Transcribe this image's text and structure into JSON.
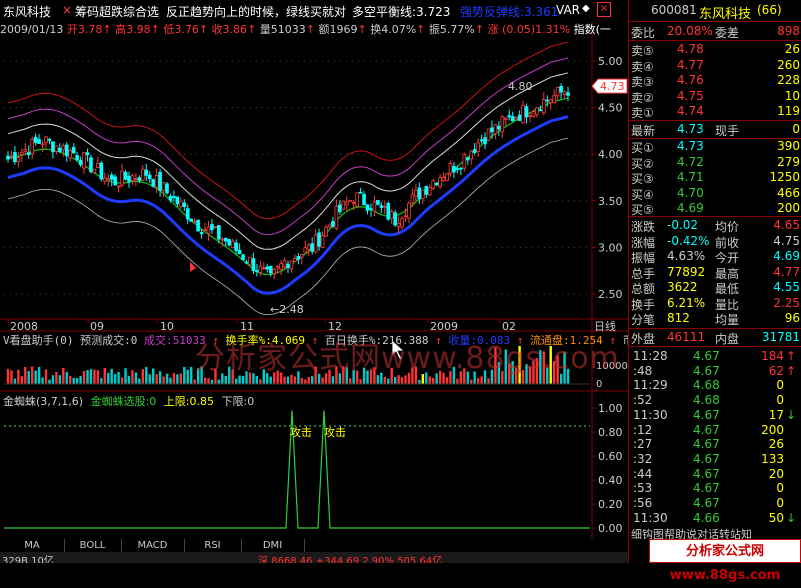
{
  "header": {
    "stock_name": "东风科技",
    "formula_name": "筹码超跌综合选",
    "slogan": "反正趋势向上的时候，绿线买就对",
    "balance_label": "多空平衡线:3.723",
    "rebound_label": "强势反弹线:3.361",
    "var_label": "VAR"
  },
  "ohlc_line": {
    "date": "2009/01/13",
    "open": "开3.78",
    "high": "高3.98",
    "low": "低3.76",
    "close": "收3.86",
    "volume": "量51033",
    "amount": "额1969",
    "turnover": "换4.07%",
    "amplitude": "振5.77%",
    "change": "涨 (0.05)1.31%",
    "index_label": "指数(一"
  },
  "price_axis": [
    "5.00",
    "4.50",
    "4.00",
    "3.50",
    "3.00",
    "2.50"
  ],
  "price_annotations": {
    "high_marker": "4.80",
    "low_marker": "2.48",
    "current_tag": "4.73"
  },
  "time_axis": [
    "2008",
    "09",
    "10",
    "11",
    "12",
    "2009",
    "02"
  ],
  "time_axis_right": "日线",
  "volume_panel": {
    "title": "V看盘助手(0)",
    "predict": "预测成交:0",
    "volume": "成交:51033",
    "turnover": "换手率%:4.069",
    "hundred_day": "百日换手%:216.388",
    "harvest": "收量:0.083",
    "circulation": "流通盘:1.254",
    "extra": "币",
    "axis": [
      "100000",
      "0"
    ]
  },
  "spider_panel": {
    "title": "金蜘蛛(3,7,1,6)",
    "select": "金蜘蛛选股:0",
    "upper": "上限:0.85",
    "lower": "下限:0",
    "attack1": "攻击",
    "attack2": "攻击",
    "axis": [
      "1.00",
      "0.80",
      "0.60",
      "0.40",
      "0.20",
      "0.00"
    ]
  },
  "tabs": [
    "MA",
    "BOLL",
    "MACD",
    "RSI",
    "DMI"
  ],
  "status_bar": {
    "left": "329B 10亿",
    "mid": "深 8668.46 +344.69 2.90% 505.64亿"
  },
  "watermark": "分析家公式网www.88gs.com",
  "watermark_box": "分析家公式网www.88gs.com",
  "quote": {
    "code": "600081",
    "name": "东风科技",
    "rank": "(66)",
    "weibi_label": "委比",
    "weibi_value": "20.08%",
    "weicha_label": "委差",
    "weicha_value": "898",
    "asks": [
      {
        "label": "卖⑤",
        "price": "4.78",
        "vol": "26"
      },
      {
        "label": "卖④",
        "price": "4.77",
        "vol": "260"
      },
      {
        "label": "卖③",
        "price": "4.76",
        "vol": "228"
      },
      {
        "label": "卖②",
        "price": "4.75",
        "vol": "10"
      },
      {
        "label": "卖①",
        "price": "4.74",
        "vol": "119"
      }
    ],
    "latest_label": "最新",
    "latest_value": "4.73",
    "xianshou_label": "现手",
    "xianshou_value": "0",
    "bids": [
      {
        "label": "买①",
        "price": "4.73",
        "vol": "390"
      },
      {
        "label": "买②",
        "price": "4.72",
        "vol": "279"
      },
      {
        "label": "买③",
        "price": "4.71",
        "vol": "1250"
      },
      {
        "label": "买④",
        "price": "4.70",
        "vol": "466"
      },
      {
        "label": "买⑤",
        "price": "4.69",
        "vol": "200"
      }
    ],
    "stats": [
      {
        "l1": "涨跌",
        "v1": "-0.02",
        "l2": "均价",
        "v2": "4.65"
      },
      {
        "l1": "涨幅",
        "v1": "-0.42%",
        "l2": "前收",
        "v2": "4.75"
      },
      {
        "l1": "振幅",
        "v1": "4.63%",
        "l2": "今开",
        "v2": "4.69"
      },
      {
        "l1": "总手",
        "v1": "77892",
        "l2": "最高",
        "v2": "4.77"
      },
      {
        "l1": "总额",
        "v1": "3622",
        "l2": "最低",
        "v2": "4.55"
      },
      {
        "l1": "换手",
        "v1": "6.21%",
        "l2": "量比",
        "v2": "2.25"
      },
      {
        "l1": "分笔",
        "v1": "812",
        "l2": "均量",
        "v2": "96"
      }
    ],
    "waipan_label": "外盘",
    "waipan_value": "46111",
    "neipan_label": "内盘",
    "neipan_value": "31781",
    "ticks": [
      {
        "time": "11:28",
        "price": "4.67",
        "vol": "184",
        "dir": "up"
      },
      {
        "time": ":48",
        "price": "4.67",
        "vol": "62",
        "dir": "up"
      },
      {
        "time": "11:29",
        "price": "4.68",
        "vol": "0",
        "dir": ""
      },
      {
        "time": ":52",
        "price": "4.68",
        "vol": "0",
        "dir": ""
      },
      {
        "time": "11:30",
        "price": "4.67",
        "vol": "17",
        "dir": "down"
      },
      {
        "time": ":12",
        "price": "4.67",
        "vol": "200",
        "dir": ""
      },
      {
        "time": ":27",
        "price": "4.67",
        "vol": "26",
        "dir": ""
      },
      {
        "time": ":32",
        "price": "4.67",
        "vol": "133",
        "dir": ""
      },
      {
        "time": ":44",
        "price": "4.67",
        "vol": "20",
        "dir": ""
      },
      {
        "time": ":53",
        "price": "4.67",
        "vol": "0",
        "dir": ""
      },
      {
        "time": ":56",
        "price": "4.67",
        "vol": "0",
        "dir": ""
      },
      {
        "time": "11:30",
        "price": "4.66",
        "vol": "50",
        "dir": "down"
      }
    ],
    "footer": "细钩图帮助说对话转站知"
  },
  "colors": {
    "up": "#ff3b3b",
    "down": "#00ffff",
    "blue_band": "#1e3cff",
    "green_band": "#14b414",
    "red_band": "#c81414",
    "purple_band": "#c83cc8",
    "white_band": "#dcdcdc",
    "grid": "#800000"
  }
}
